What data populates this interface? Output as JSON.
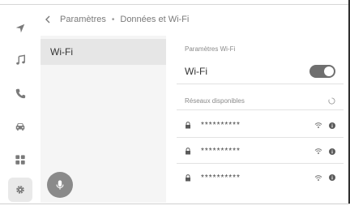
{
  "header": {
    "back_icon": "chevron-left-icon",
    "breadcrumb_parent": "Paramètres",
    "separator": "•",
    "breadcrumb_current": "Données et Wi-Fi"
  },
  "sidebar": {
    "items": [
      {
        "icon": "navigation-icon"
      },
      {
        "icon": "music-icon"
      },
      {
        "icon": "phone-icon"
      },
      {
        "icon": "car-icon"
      },
      {
        "icon": "apps-grid-icon"
      },
      {
        "icon": "gear-icon",
        "active": true
      }
    ]
  },
  "list": {
    "items": [
      {
        "label": "Wi-Fi",
        "selected": true
      }
    ]
  },
  "voice": {
    "icon": "microphone-icon"
  },
  "settings": {
    "section_title": "Paramètres Wi-Fi",
    "wifi_label": "Wi-Fi",
    "wifi_enabled": true,
    "available_title": "Réseaux disponibles",
    "networks": [
      {
        "name": "**********",
        "locked": true
      },
      {
        "name": "**********",
        "locked": true
      },
      {
        "name": "**********",
        "locked": true
      }
    ]
  },
  "colors": {
    "accent_toggle": "#6f6f6f",
    "panel_bg": "#f5f5f5",
    "selected_bg": "#e6e6e6",
    "mic_bg": "#8a8a8a"
  }
}
